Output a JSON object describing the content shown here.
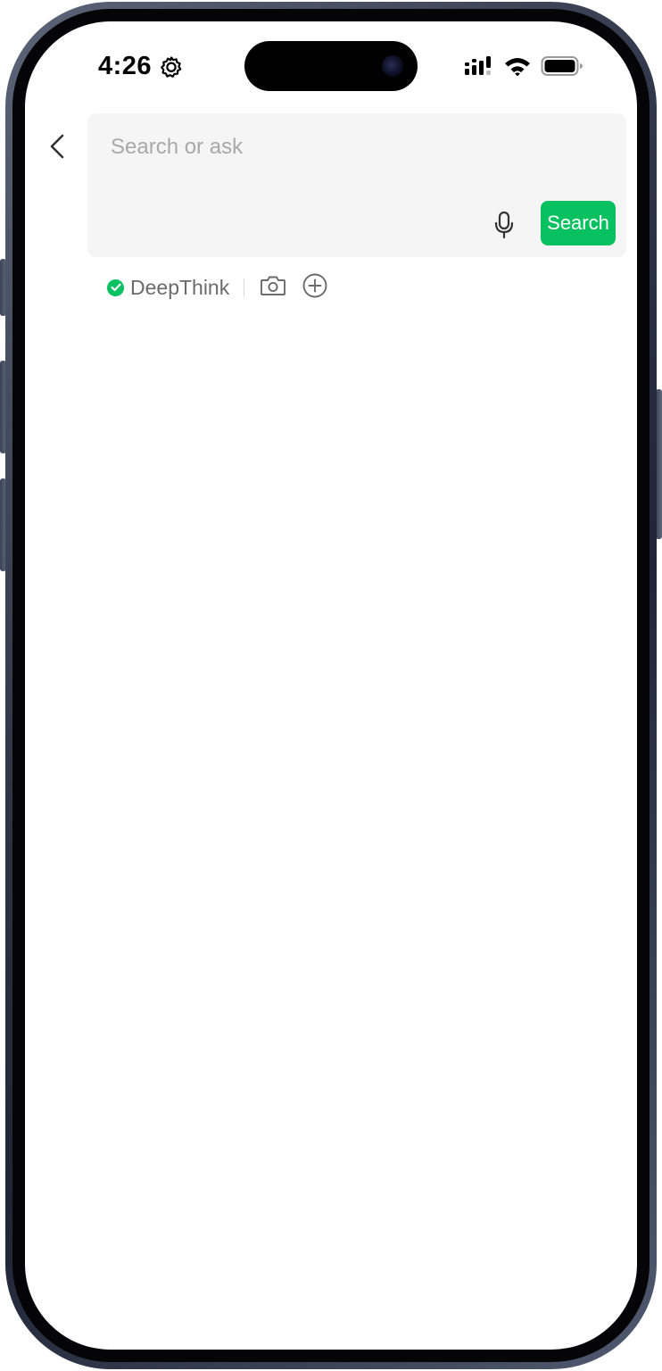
{
  "status_bar": {
    "time": "4:26"
  },
  "search": {
    "placeholder": "Search or ask",
    "value": "",
    "button_label": "Search"
  },
  "options": {
    "deepthink_label": "DeepThink",
    "deepthink_enabled": true
  },
  "colors": {
    "accent": "#07c160",
    "input_background": "#f5f5f5",
    "placeholder": "#a9a9a9"
  },
  "icons": {
    "back": "chevron-left-icon",
    "microphone": "microphone-icon",
    "camera": "camera-icon",
    "add": "plus-circle-icon",
    "check": "check-circle-icon",
    "status_gear": "gear-icon",
    "signal": "signal-icon",
    "wifi": "wifi-icon",
    "battery": "battery-icon"
  }
}
